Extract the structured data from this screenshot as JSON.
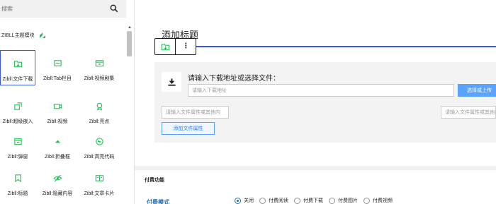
{
  "sidebar": {
    "search_placeholder": "搜索",
    "category": "ZIBLL主题模块",
    "blocks": [
      {
        "label": "Zibll:文件下载",
        "icon": "file-download-icon"
      },
      {
        "label": "Zibll:Tab栏目",
        "icon": "tab-icon"
      },
      {
        "label": "Zibll:视频剧集",
        "icon": "video-episodes-icon"
      },
      {
        "label": "Zibll:超级嵌入",
        "icon": "embed-icon"
      },
      {
        "label": "Zibll:视频",
        "icon": "video-icon"
      },
      {
        "label": "Zibll:亮点",
        "icon": "highlight-icon"
      },
      {
        "label": "Zibll:弹窗",
        "icon": "modal-icon"
      },
      {
        "label": "Zibll:折叠框",
        "icon": "collapse-icon"
      },
      {
        "label": "Zibll:高亮代码",
        "icon": "code-highlight-icon"
      },
      {
        "label": "Zibll:标题",
        "icon": "title-icon"
      },
      {
        "label": "Zibll:隐藏内容",
        "icon": "hidden-content-icon"
      },
      {
        "label": "Zibll:文章卡片",
        "icon": "post-card-icon"
      }
    ]
  },
  "editor": {
    "heading": "添加标题",
    "download": {
      "prompt": "请输入下载地址或选择文件：",
      "url_placeholder": "请输入下载地址",
      "upload_label": "选择或上传",
      "attr_placeholder": "请输入文件属性或其他内",
      "attr_placeholder_2": "请输入文件属性或其他内",
      "add_attr_label": "添加文件属性"
    }
  },
  "meta": {
    "section_title": "付费功能",
    "pay_mode_label": "付费模式",
    "options": [
      "关闭",
      "付费阅读",
      "付费下载",
      "付费图片",
      "付费视频"
    ],
    "selected": "关闭"
  },
  "colors": {
    "accent": "#3858e9",
    "upload": "#5aa3ff",
    "link": "#2271b1"
  }
}
